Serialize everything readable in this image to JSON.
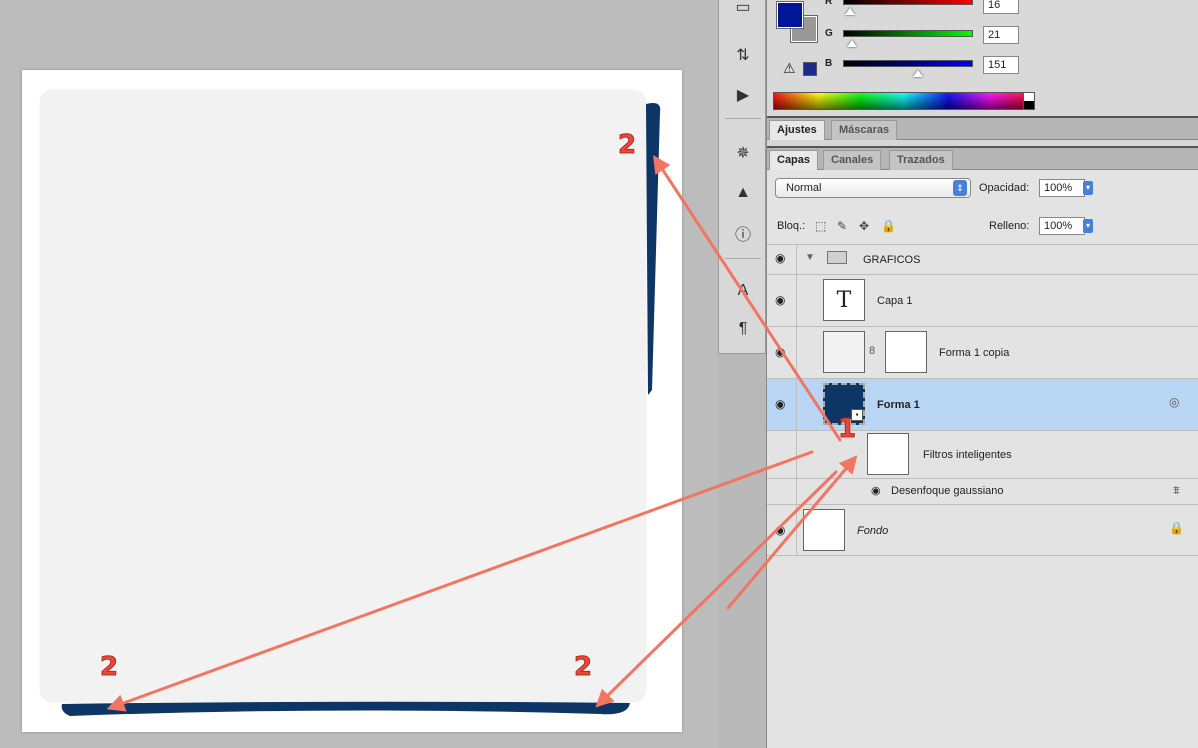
{
  "annotations": {
    "step1": "1",
    "step2": "2"
  },
  "color_panel": {
    "foreground_color": "#001597",
    "channels": [
      {
        "label": "R",
        "value": "16"
      },
      {
        "label": "G",
        "value": "21"
      },
      {
        "label": "B",
        "value": "151"
      }
    ]
  },
  "adjust_tabs": {
    "ajustes": "Ajustes",
    "mascaras": "Máscaras"
  },
  "layer_tabs": {
    "capas": "Capas",
    "canales": "Canales",
    "trazados": "Trazados"
  },
  "layers_panel": {
    "blend_mode": "Normal",
    "opacity_label": "Opacidad:",
    "opacity_value": "100%",
    "lock_label": "Bloq.:",
    "fill_label": "Relleno:",
    "fill_value": "100%",
    "group_name": "GRAFICOS",
    "layers": {
      "capa1": "Capa 1",
      "forma1_copia": "Forma 1 copia",
      "forma1": "Forma 1",
      "filtros": "Filtros inteligentes",
      "desenfoque": "Desenfoque gaussiano",
      "fondo": "Fondo"
    }
  },
  "colors": {
    "accent_arrow": "#f07662",
    "shape_blue": "#0d3566",
    "selection": "#b8d6f3"
  },
  "icons": [
    "eye-icon",
    "folder-icon",
    "lock-icon",
    "chain-link-icon",
    "smart-object-icon",
    "text-layer-icon",
    "warning-icon"
  ]
}
